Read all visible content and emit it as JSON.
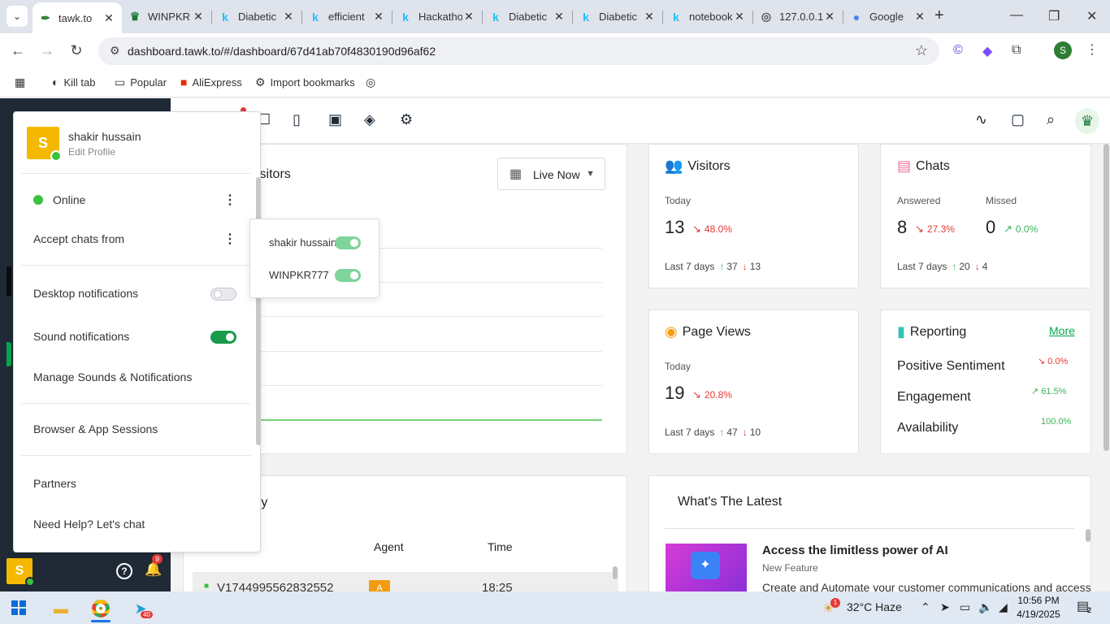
{
  "browser": {
    "tabs": [
      {
        "title": "tawk.to",
        "fav": "✒",
        "fav_color": "#2e7d32"
      },
      {
        "title": "WINPKR",
        "fav": "♛",
        "fav_color": "#1b7a35"
      },
      {
        "title": "Diabetic",
        "fav": "k",
        "fav_color": "#20beff"
      },
      {
        "title": "efficient",
        "fav": "k",
        "fav_color": "#20beff"
      },
      {
        "title": "Hackathon",
        "fav": "k",
        "fav_color": "#20beff"
      },
      {
        "title": "Diabetic",
        "fav": "k",
        "fav_color": "#20beff"
      },
      {
        "title": "Diabetic",
        "fav": "k",
        "fav_color": "#20beff"
      },
      {
        "title": "notebook",
        "fav": "k",
        "fav_color": "#20beff"
      },
      {
        "title": "127.0.0.1",
        "fav": "◎",
        "fav_color": "#555"
      },
      {
        "title": "Google",
        "fav": "●",
        "fav_color": "#4285f4"
      }
    ],
    "url": "dashboard.tawk.to/#/dashboard/67d41ab70f4830190d96af62",
    "profile_initial": "S",
    "bookmarks": [
      {
        "label": "Kill tab",
        "icon": "◐"
      },
      {
        "label": "Popular",
        "icon": "▭"
      },
      {
        "label": "AliExpress",
        "icon": "■"
      },
      {
        "label": "Import bookmarks",
        "icon": "⚙"
      }
    ]
  },
  "menu": {
    "initial": "S",
    "name": "shakir hussain",
    "edit_profile": "Edit Profile",
    "status": "Online",
    "accept_chats": "Accept chats from",
    "desktop_notifications": "Desktop notifications",
    "sound_notifications": "Sound notifications",
    "manage_sounds": "Manage Sounds & Notifications",
    "browser_sessions": "Browser & App Sessions",
    "partners": "Partners",
    "need_help": "Need Help? Let's chat"
  },
  "accept_popup": {
    "items": [
      "shakir hussain",
      "WINPKR777"
    ]
  },
  "rail": {
    "initial": "S",
    "notif_count": "9"
  },
  "visitors_panel": {
    "title_fragment": "isitors",
    "range": "Live Now"
  },
  "visitors_card": {
    "title": "Visitors",
    "today_label": "Today",
    "today_value": "13",
    "today_pct": "48.0%",
    "last7_label": "Last 7 days",
    "last7_up": "37",
    "last7_down": "13"
  },
  "chats_card": {
    "title": "Chats",
    "answered_label": "Answered",
    "answered_value": "8",
    "answered_pct": "27.3%",
    "missed_label": "Missed",
    "missed_value": "0",
    "missed_pct": "0.0%",
    "last7_label": "Last 7 days",
    "last7_up": "20",
    "last7_down": "4"
  },
  "pageviews_card": {
    "title": "Page Views",
    "today_label": "Today",
    "today_value": "19",
    "today_pct": "20.8%",
    "last7_label": "Last 7 days",
    "last7_up": "47",
    "last7_down": "10"
  },
  "reporting_card": {
    "title": "Reporting",
    "more": "More",
    "rows": [
      {
        "label": "Positive Sentiment",
        "pct": "0.0%"
      },
      {
        "label": "Engagement",
        "pct": "61.5%"
      },
      {
        "label": "Availability",
        "pct": "100.0%"
      }
    ]
  },
  "history_card": {
    "title_fragment": "ry",
    "columns": [
      "Agent",
      "Time"
    ],
    "row": {
      "visitor": "V1744995562832552",
      "agent": "A",
      "time": "18:25"
    }
  },
  "latest_card": {
    "title": "What's The Latest",
    "item_title": "Access the limitless power of AI",
    "item_tag": "New Feature",
    "item_desc": "Create and Automate your customer communications and access"
  },
  "taskbar": {
    "weather": "32°C  Haze",
    "weather_badge": "1",
    "time": "10:56 PM",
    "date": "4/19/2025",
    "notif": "2",
    "telegram_badge": "40"
  },
  "colors": {
    "brand_green": "#03a84e",
    "avatar_yellow": "#f5b800",
    "rail_dark": "#1f2a36",
    "down_red": "#e53935",
    "up_green": "#3db25a"
  }
}
